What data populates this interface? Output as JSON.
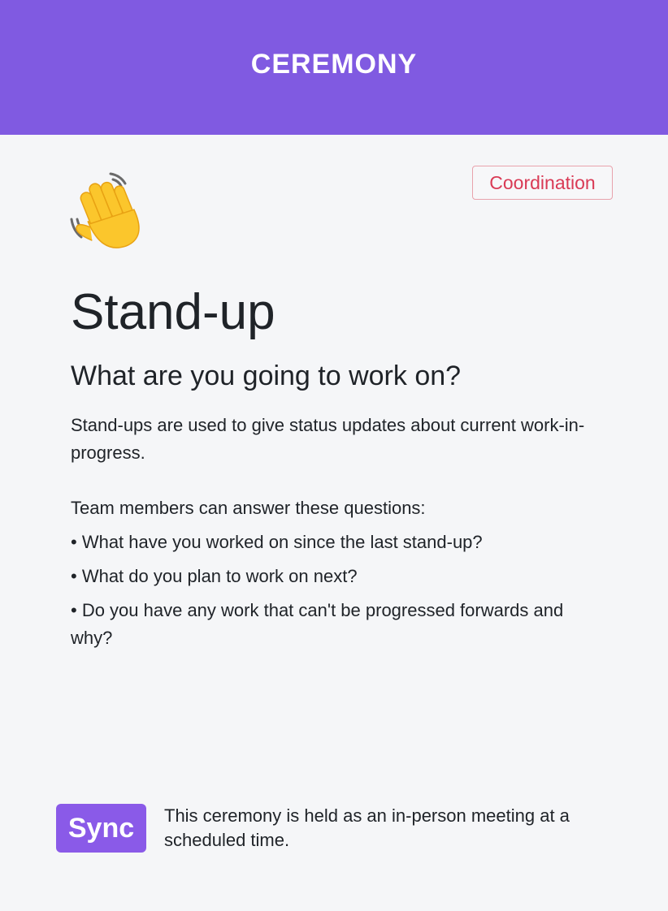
{
  "header": {
    "title": "CEREMONY"
  },
  "card": {
    "category": "Coordination",
    "icon": "waving-hand-icon",
    "title": "Stand-up",
    "subtitle": "What are you going to work on?",
    "description": "Stand-ups are used to give status updates about current work-in-progress.",
    "questions_intro": "Team members can answer these questions:",
    "questions": [
      "• What have you worked on since the last stand-up?",
      "• What do you plan to work on next?",
      "• Do you have any work that can't be progressed forwards and why?"
    ]
  },
  "footer": {
    "badge": "Sync",
    "text": "This ceremony is held as an in-person meeting at a scheduled time."
  },
  "colors": {
    "header_bg": "#805ae1",
    "page_bg": "#f5f6f8",
    "category_text": "#d93a55",
    "category_border": "#e8a2ac",
    "sync_bg": "#8a5ae8",
    "hand_yellow": "#fbc62c"
  }
}
